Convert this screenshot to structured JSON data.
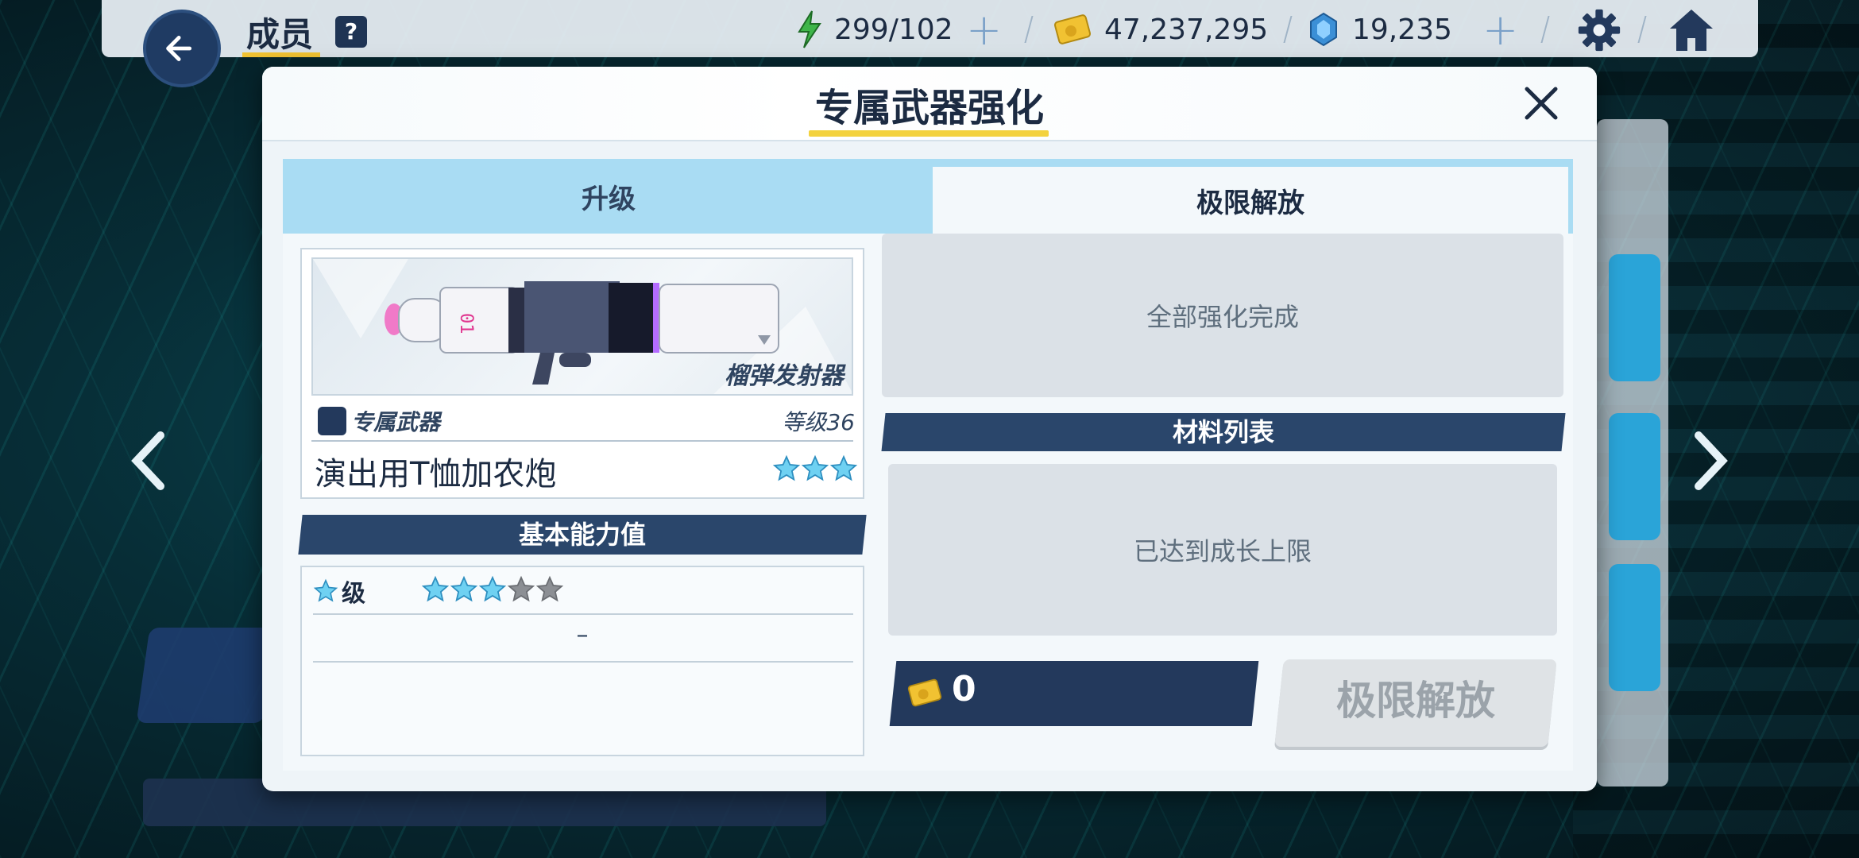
{
  "header": {
    "title": "成员",
    "help_label": "?",
    "stamina": "299/102",
    "coins": "47,237,295",
    "gems": "19,235"
  },
  "modal": {
    "title": "专属武器强化",
    "tabs": [
      {
        "label": "升级"
      },
      {
        "label": "极限解放"
      }
    ],
    "weapon": {
      "type_label": "榴弹发射器",
      "category_label": "专属武器",
      "level_label": "等级36",
      "name": "演出用T恤加农炮",
      "stars": 3
    },
    "basic_stats": {
      "banner": "基本能力值",
      "star_level_label": "级",
      "star_level_filled": 3,
      "star_level_total": 5,
      "value": "–"
    },
    "status": {
      "all_done": "全部强化完成",
      "materials_banner": "材料列表",
      "growth_limit": "已达到成长上限"
    },
    "cost": "0",
    "limit_break_button": "极限解放"
  },
  "colors": {
    "navy": "#23395c",
    "tab_blue": "#a9dcf3",
    "title_underline": "#f3d23e"
  }
}
